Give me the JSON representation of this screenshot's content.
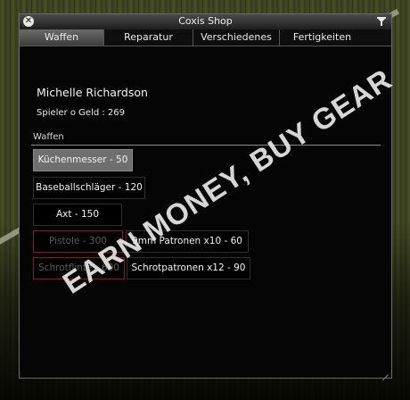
{
  "window": {
    "title": "Coxis Shop"
  },
  "tabs": [
    {
      "label": "Waffen",
      "active": true
    },
    {
      "label": "Reparatur",
      "active": false
    },
    {
      "label": "Verschiedenes",
      "active": false
    },
    {
      "label": "Fertigkeiten",
      "active": false
    }
  ],
  "player": {
    "name": "Michelle Richardson",
    "info": "Spieler o Geld : 269"
  },
  "section": {
    "label": "Waffen"
  },
  "items": [
    {
      "label": "Küchenmesser - 50",
      "state": "selected"
    },
    {
      "label": "Baseballschläger - 120",
      "state": "normal"
    },
    {
      "label": "Axt - 150",
      "state": "normal"
    },
    {
      "label": "Pistole - 300",
      "state": "disabled"
    },
    {
      "label": "9mm Patronen x10 - 60",
      "state": "normal"
    },
    {
      "label": "Schrotflinte - 600",
      "state": "disabled"
    },
    {
      "label": "Schrotpatronen x12 - 90",
      "state": "normal"
    }
  ],
  "watermark": "EARN MONEY, BUY GEAR",
  "colors": {
    "window_bg": "#050505",
    "tab_active": "#5a5a5a",
    "item_selected": "#6f6f6f",
    "item_disabled_border": "#8a1a1a",
    "watermark": "#e8e8e8"
  }
}
